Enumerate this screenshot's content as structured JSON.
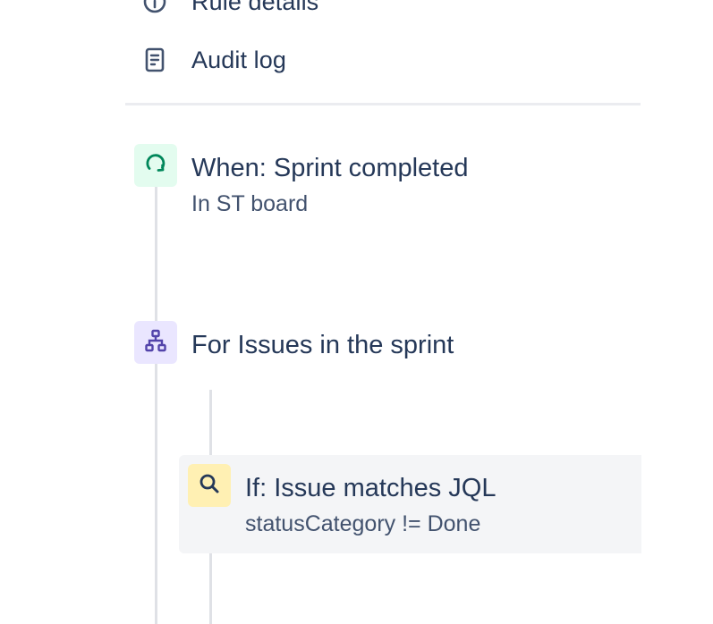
{
  "nav": {
    "rule_details_label": "Rule details",
    "audit_log_label": "Audit log"
  },
  "rule": {
    "trigger": {
      "title": "When: Sprint completed",
      "subtitle": "In ST board",
      "icon": "sprint-trigger-icon",
      "color": "#36b37e",
      "bg": "#e3fcef"
    },
    "branch": {
      "title": "For Issues in the sprint",
      "icon": "branch-icon",
      "color": "#6554c0",
      "bg": "#eae6ff"
    },
    "condition": {
      "title": "If: Issue matches JQL",
      "subtitle": "statusCategory != Done",
      "icon": "search-icon",
      "color": "#253858",
      "bg": "#fff0b3"
    }
  }
}
